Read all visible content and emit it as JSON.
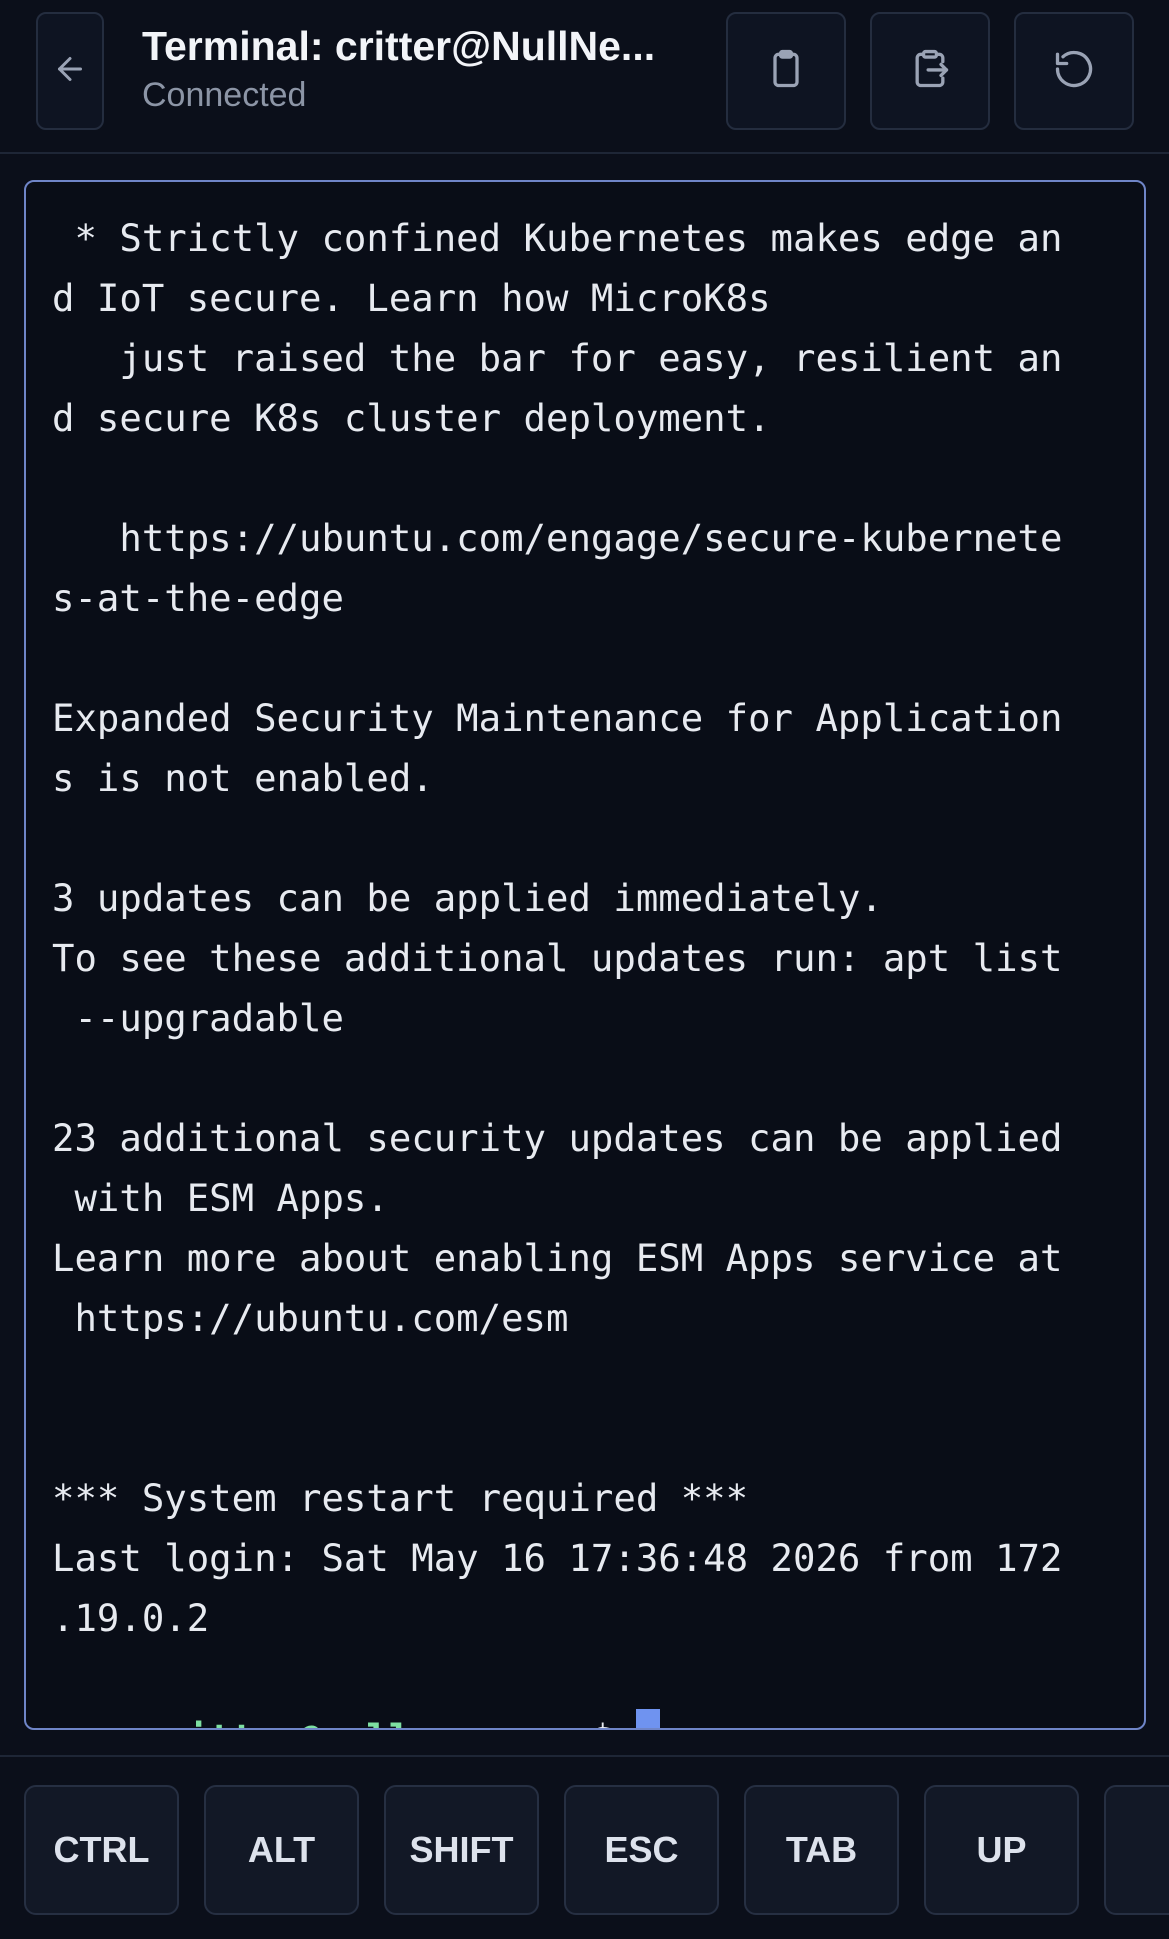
{
  "header": {
    "title": "Terminal: critter@NullNe...",
    "status": "Connected",
    "icons": {
      "back": "arrow-left-icon",
      "copy": "clipboard-icon",
      "paste": "clipboard-paste-icon",
      "reload": "refresh-icon"
    }
  },
  "terminal": {
    "lines": [
      " * Strictly confined Kubernetes makes edge an",
      "d IoT secure. Learn how MicroK8s",
      "   just raised the bar for easy, resilient an",
      "d secure K8s cluster deployment.",
      "",
      "   https://ubuntu.com/engage/secure-kubernete",
      "s-at-the-edge",
      "",
      "Expanded Security Maintenance for Application",
      "s is not enabled.",
      "",
      "3 updates can be applied immediately.",
      "To see these additional updates run: apt list",
      " --upgradable",
      "",
      "23 additional security updates can be applied",
      " with ESM Apps.",
      "Learn more about enabling ESM Apps service at",
      " https://ubuntu.com/esm",
      "",
      "",
      "*** System restart required ***",
      "Last login: Sat May 16 17:36:48 2026 from 172",
      ".19.0.2"
    ],
    "prompt": {
      "user_host": "critter@null-nexus",
      "separator": ":",
      "path": "~",
      "symbol": "$ "
    }
  },
  "keys": [
    "CTRL",
    "ALT",
    "SHIFT",
    "ESC",
    "TAB",
    "UP",
    ""
  ],
  "colors": {
    "background": "#0b0f1a",
    "terminal_border": "#6f85c8",
    "prompt_user": "#7ee0a2",
    "prompt_path": "#7fa2ff",
    "cursor": "#6f93f0"
  }
}
